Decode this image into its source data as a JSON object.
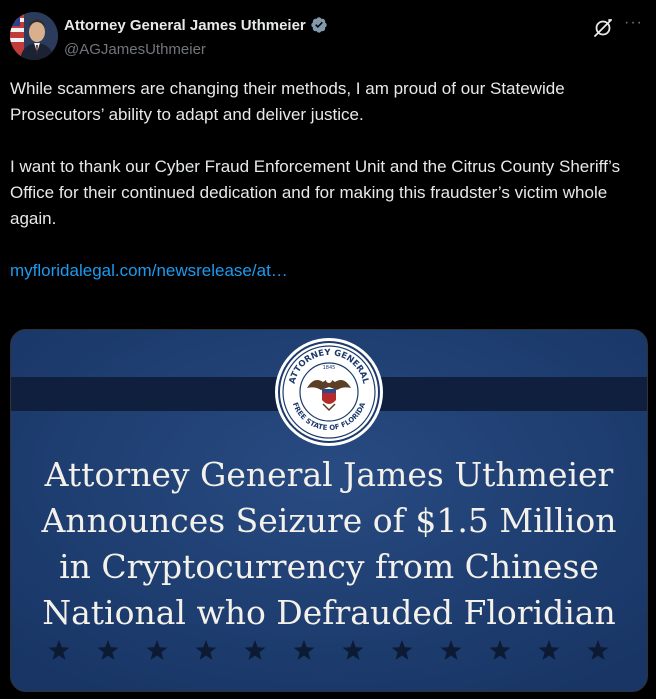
{
  "author": {
    "name": "Attorney General James Uthmeier",
    "handle": "@AGJamesUthmeier",
    "verified": true,
    "avatar": "avatar-photo"
  },
  "icons": {
    "verified": "verified-badge-icon",
    "grok": "grok-icon",
    "more": "more-icon"
  },
  "more_glyph": "···",
  "post": {
    "paragraph1": "While scammers are changing their methods, I am proud of our Statewide Prosecutors’ ability to adapt and deliver justice.",
    "paragraph2": "I want to thank our Cyber Fraud Enforcement Unit and the Citrus County Sheriff’s Office for their continued dedication and for making this fraudster’s victim whole again.",
    "link": "myfloridalegal.com/newsrelease/at…"
  },
  "media": {
    "seal_top": "ATTORNEY GENERAL",
    "seal_bottom": "FREE STATE OF FLORIDA",
    "seal_year": "1845",
    "headline_lines": [
      "Attorney General James Uthmeier",
      "Announces Seizure of $1.5 Million",
      "in Cryptocurrency from Chinese",
      "National who Defrauded Floridian"
    ],
    "star_count": 12
  },
  "colors": {
    "background": "#000000",
    "text": "#e7e9ea",
    "secondary": "#71767b",
    "link": "#1d9bf0",
    "verified": "#829aab",
    "banner_blue": "#1d3a6b",
    "banner_stripe": "#0f1f3d"
  }
}
